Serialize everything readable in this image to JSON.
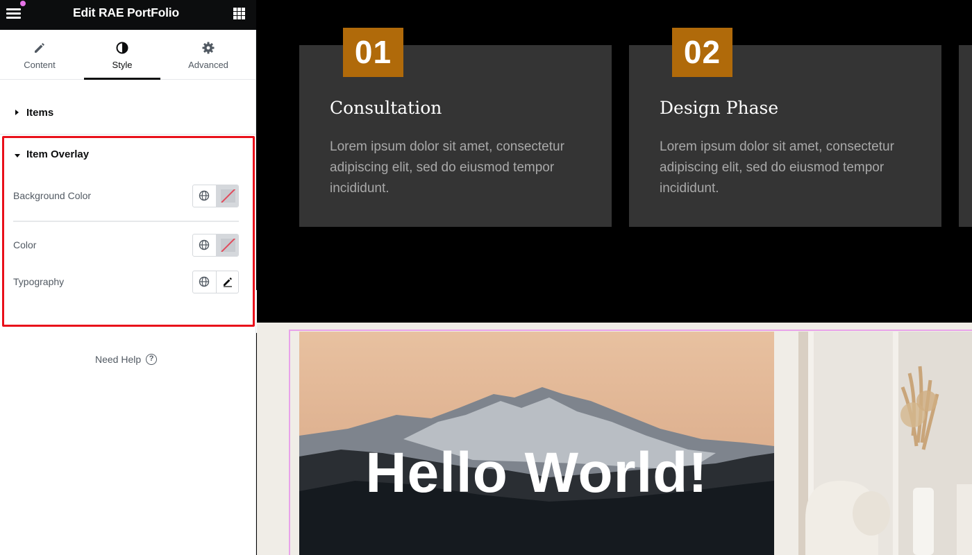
{
  "editor": {
    "title": "Edit RAE PortFolio",
    "tabs": [
      {
        "label": "Content",
        "icon": "pencil-icon",
        "active": false
      },
      {
        "label": "Style",
        "icon": "contrast-icon",
        "active": true
      },
      {
        "label": "Advanced",
        "icon": "gear-icon",
        "active": false
      }
    ],
    "sections": {
      "items_label": "Items",
      "overlay_label": "Item Overlay"
    },
    "controls": {
      "background_color_label": "Background Color",
      "color_label": "Color",
      "typography_label": "Typography"
    },
    "need_help": "Need Help",
    "help_glyph": "?"
  },
  "preview": {
    "cards": [
      {
        "number": "01",
        "title": "Consultation",
        "text": "Lorem ipsum dolor sit amet, consectetur adipiscing elit, sed do eiusmod tempor incididunt."
      },
      {
        "number": "02",
        "title": "Design Phase",
        "text": "Lorem ipsum dolor sit amet, consectetur adipiscing elit, sed do eiusmod tempor incididunt."
      }
    ],
    "portfolio_image_text": "Hello World!"
  },
  "colors": {
    "accent_number_bg": "#b06a0a",
    "highlight_border": "#e9101a",
    "card_bg": "#343434",
    "notification_dot": "#e673e8"
  }
}
